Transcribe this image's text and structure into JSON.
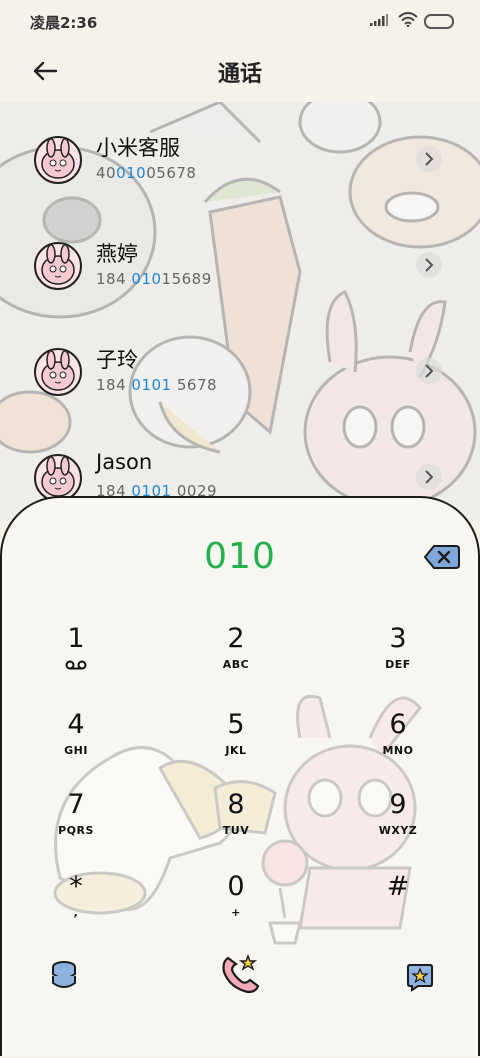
{
  "status": {
    "time": "凌晨2:36"
  },
  "header": {
    "title": "通话"
  },
  "contacts": [
    {
      "name": "小米客服",
      "num_pre": "40",
      "num_hl": "010",
      "num_post": "05678"
    },
    {
      "name": "燕婷",
      "num_pre": "184 ",
      "num_hl": "010",
      "num_post": "15689"
    },
    {
      "name": "子玲",
      "num_pre": "184 ",
      "num_hl": "0101",
      "num_post": " 5678"
    },
    {
      "name": "Jason",
      "num_pre": "184 ",
      "num_hl": "0101",
      "num_post": " 0029"
    }
  ],
  "dialer": {
    "number": "010",
    "keys": [
      {
        "digit": "1",
        "letters": ""
      },
      {
        "digit": "2",
        "letters": "ABC"
      },
      {
        "digit": "3",
        "letters": "DEF"
      },
      {
        "digit": "4",
        "letters": "GHI"
      },
      {
        "digit": "5",
        "letters": "JKL"
      },
      {
        "digit": "6",
        "letters": "MNO"
      },
      {
        "digit": "7",
        "letters": "PQRS"
      },
      {
        "digit": "8",
        "letters": "TUV"
      },
      {
        "digit": "9",
        "letters": "WXYZ"
      },
      {
        "digit": "*",
        "letters": ","
      },
      {
        "digit": "0",
        "letters": "+"
      },
      {
        "digit": "#",
        "letters": ""
      }
    ]
  },
  "colors": {
    "accent_green": "#22b14c",
    "highlight_blue": "#1f86d8",
    "avatar_pink": "#fbe3e6"
  }
}
